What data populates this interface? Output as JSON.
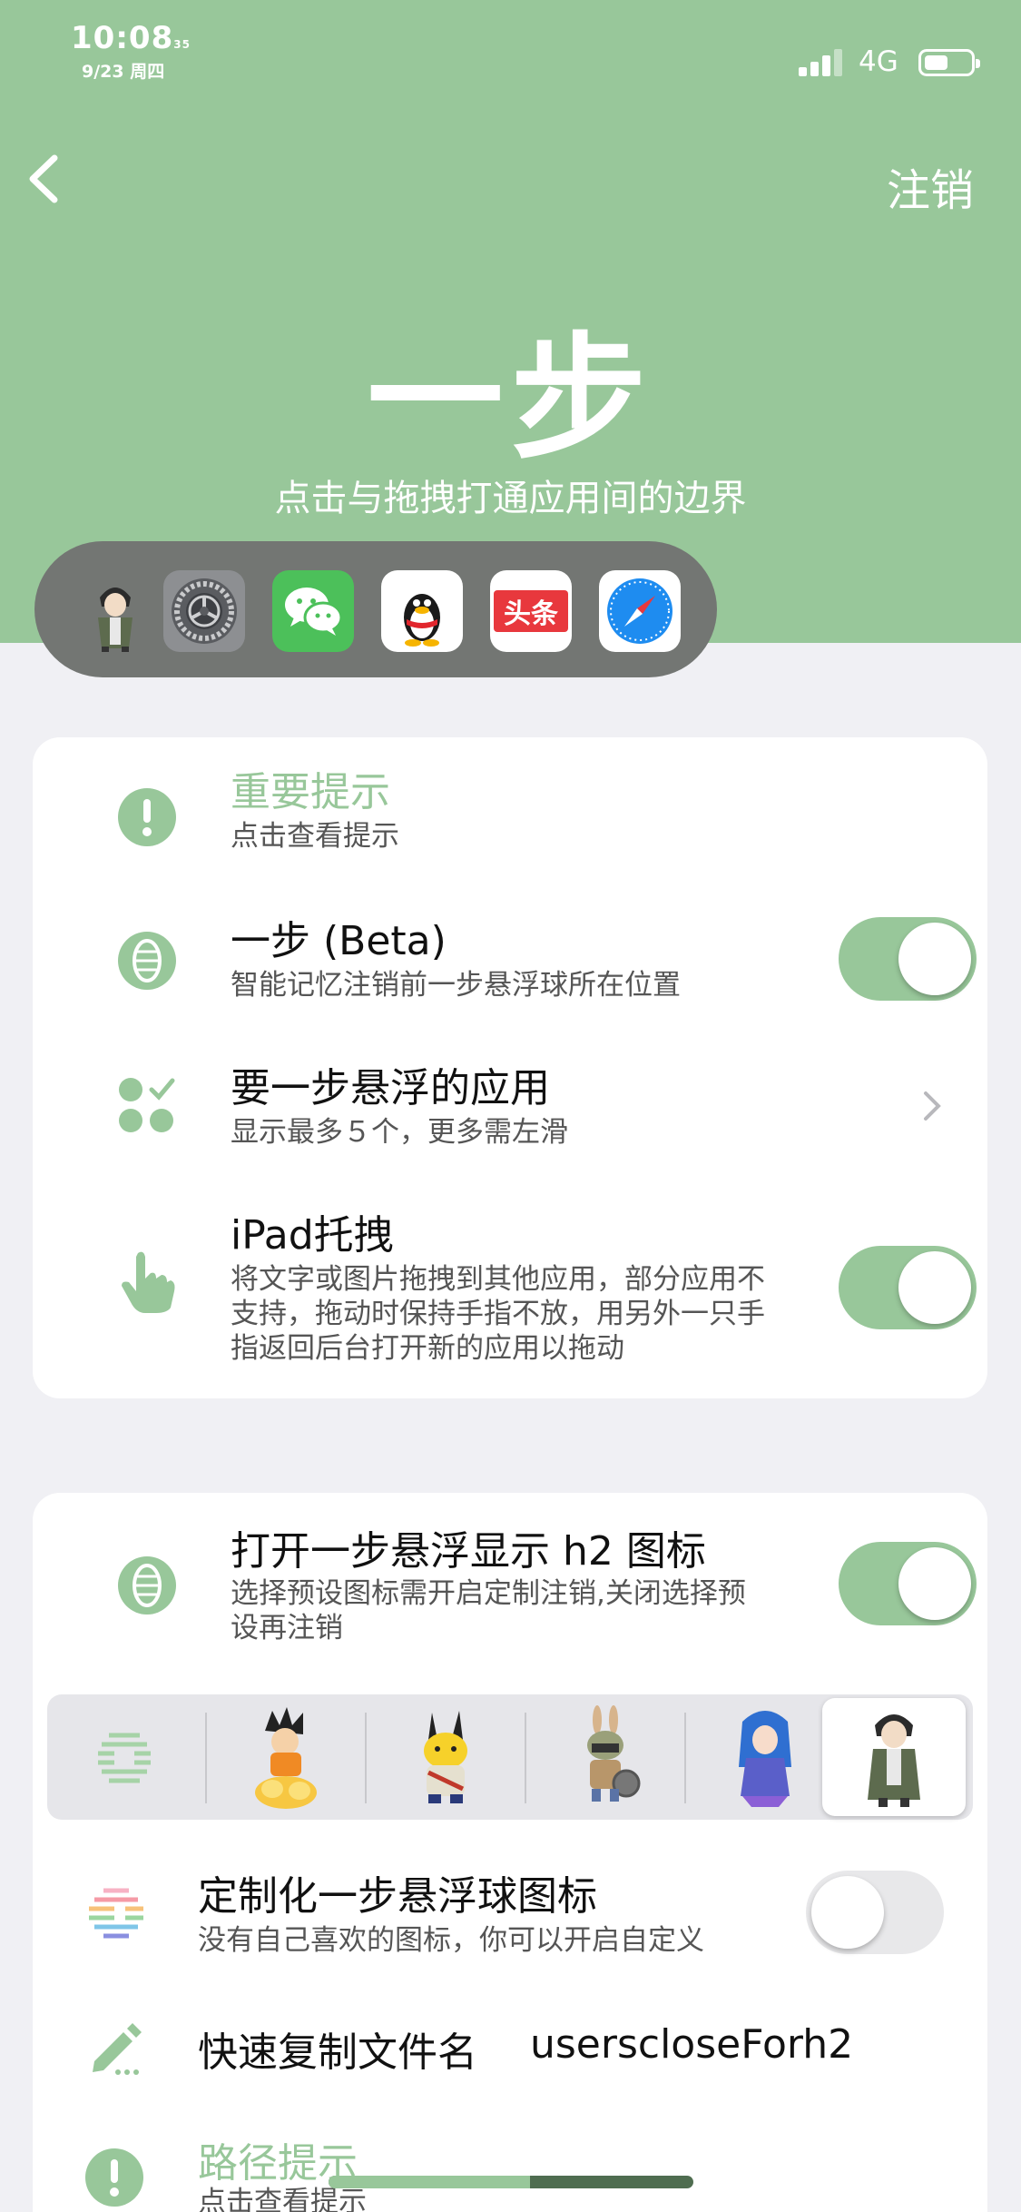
{
  "status_bar": {
    "time": "10:08",
    "seconds": "35",
    "date": "9/23 周四",
    "network": "4G",
    "battery_level": 0.5
  },
  "nav": {
    "back_icon": "chevron-left-icon",
    "logout_label": "注销"
  },
  "hero": {
    "title": "一步",
    "subtitle": "点击与拖拽打通应用间的边界"
  },
  "dock": {
    "apps": [
      "avatar-app-icon",
      "settings-app-icon",
      "wechat-app-icon",
      "qq-app-icon",
      "toutiao-app-icon",
      "safari-app-icon"
    ],
    "toutiao_label": "头条"
  },
  "section1": {
    "notice": {
      "title": "重要提示",
      "subtitle": "点击查看提示"
    },
    "beta": {
      "title": "一步 (Beta)",
      "subtitle": "智能记忆注销前一步悬浮球所在位置",
      "enabled": true
    },
    "apps": {
      "title": "要一步悬浮的应用",
      "subtitle": "显示最多５个，更多需左滑"
    },
    "ipad": {
      "title": "iPad托拽",
      "subtitle_lines": [
        "将文字或图片拖拽到其他应用，部分应用不",
        "支持，拖动时保持手指不放，用另外一只手",
        "指返回后台打开新的应用以拖动"
      ],
      "enabled": true
    }
  },
  "section2": {
    "h2": {
      "title": "打开一步悬浮显示 h2 图标",
      "subtitle_lines": [
        "选择预设图标需开启定制注销,关闭选择预",
        "设再注销"
      ],
      "enabled": true
    },
    "presets": {
      "items": [
        "striped-ball-icon",
        "goku-sticker",
        "pikachu-sticker",
        "bunny-soldier-sticker",
        "blue-hair-girl-sticker",
        "soldier-avatar-sticker"
      ],
      "selected_index": 5
    },
    "custom": {
      "title": "定制化一步悬浮球图标",
      "subtitle": "没有自己喜欢的图标，你可以开启自定义",
      "enabled": false
    },
    "copy": {
      "title": "快速复制文件名",
      "value": "userscloseForh2"
    },
    "path": {
      "title": "路径提示",
      "subtitle": "点击查看提示"
    }
  },
  "colors": {
    "accent": "#98c79a",
    "dock_bg": "#737673",
    "page_bg": "#f0f0f4",
    "card_bg": "#ffffff"
  }
}
